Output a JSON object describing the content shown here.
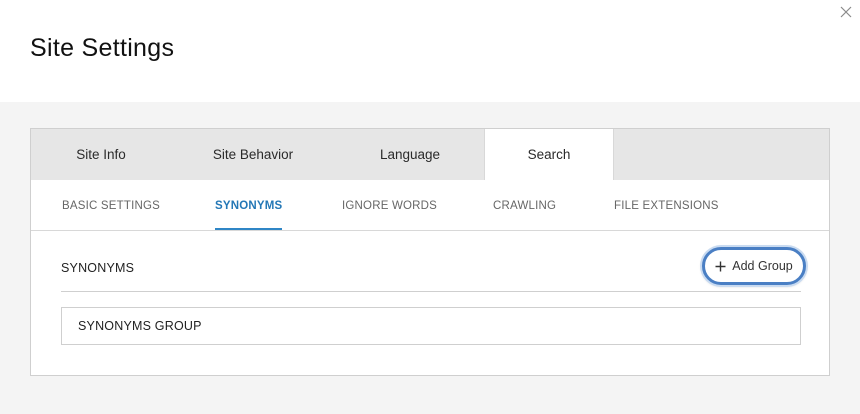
{
  "modal": {
    "title": "Site Settings",
    "close_icon": "close-icon"
  },
  "tabs": [
    {
      "label": "Site Info",
      "active": false
    },
    {
      "label": "Site Behavior",
      "active": false
    },
    {
      "label": "Language",
      "active": false
    },
    {
      "label": "Search",
      "active": true
    }
  ],
  "subtabs": [
    {
      "label": "BASIC SETTINGS",
      "active": false
    },
    {
      "label": "SYNONYMS",
      "active": true
    },
    {
      "label": "IGNORE WORDS",
      "active": false
    },
    {
      "label": "CRAWLING",
      "active": false
    },
    {
      "label": "FILE EXTENSIONS",
      "active": false
    }
  ],
  "synonyms": {
    "section_title": "SYNONYMS",
    "add_group_label": "Add Group",
    "add_group_icon": "plus-icon",
    "group_label": "SYNONYMS GROUP"
  },
  "colors": {
    "accent": "#2377b6",
    "focus_ring": "#4a7fc4",
    "tab_bar": "#e6e6e6",
    "page_bg": "#f4f4f4"
  }
}
